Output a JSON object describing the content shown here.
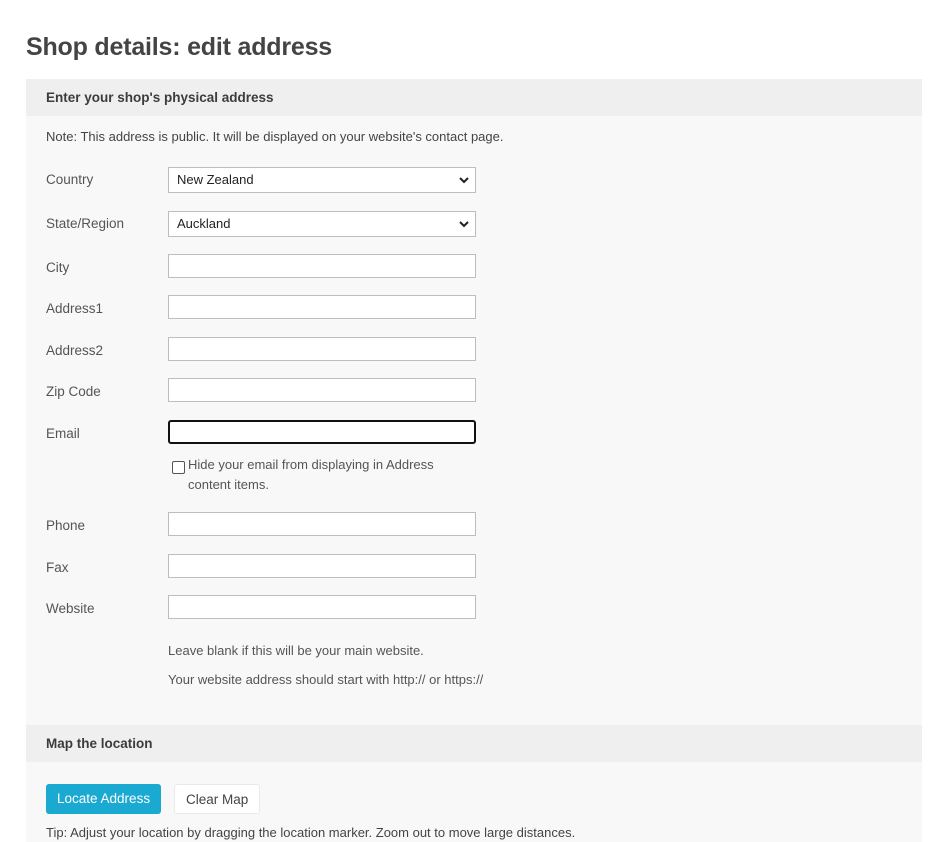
{
  "page": {
    "title": "Shop details: edit address"
  },
  "address_section": {
    "heading": "Enter your shop's physical address",
    "note": "Note: This address is public. It will be displayed on your website's contact page.",
    "fields": {
      "country": {
        "label": "Country",
        "value": "New Zealand"
      },
      "state": {
        "label": "State/Region",
        "value": "Auckland"
      },
      "city": {
        "label": "City",
        "value": ""
      },
      "address1": {
        "label": "Address1",
        "value": ""
      },
      "address2": {
        "label": "Address2",
        "value": ""
      },
      "zip": {
        "label": "Zip Code",
        "value": ""
      },
      "email": {
        "label": "Email",
        "value": ""
      },
      "phone": {
        "label": "Phone",
        "value": ""
      },
      "fax": {
        "label": "Fax",
        "value": ""
      },
      "website": {
        "label": "Website",
        "value": ""
      }
    },
    "hide_email": {
      "label": "Hide your email from displaying in Address content items.",
      "checked": false
    },
    "website_hints": [
      "Leave blank if this will be your main website.",
      "Your website address should start with http:// or https://"
    ]
  },
  "map_section": {
    "heading": "Map the location",
    "locate_button": "Locate Address",
    "clear_button": "Clear Map",
    "tip": "Tip: Adjust your location by dragging the location marker. Zoom out to move large distances."
  },
  "colors": {
    "primary_button": "#1aa9d0",
    "panel_header": "#efefef",
    "panel_body": "#f8f8f8"
  }
}
